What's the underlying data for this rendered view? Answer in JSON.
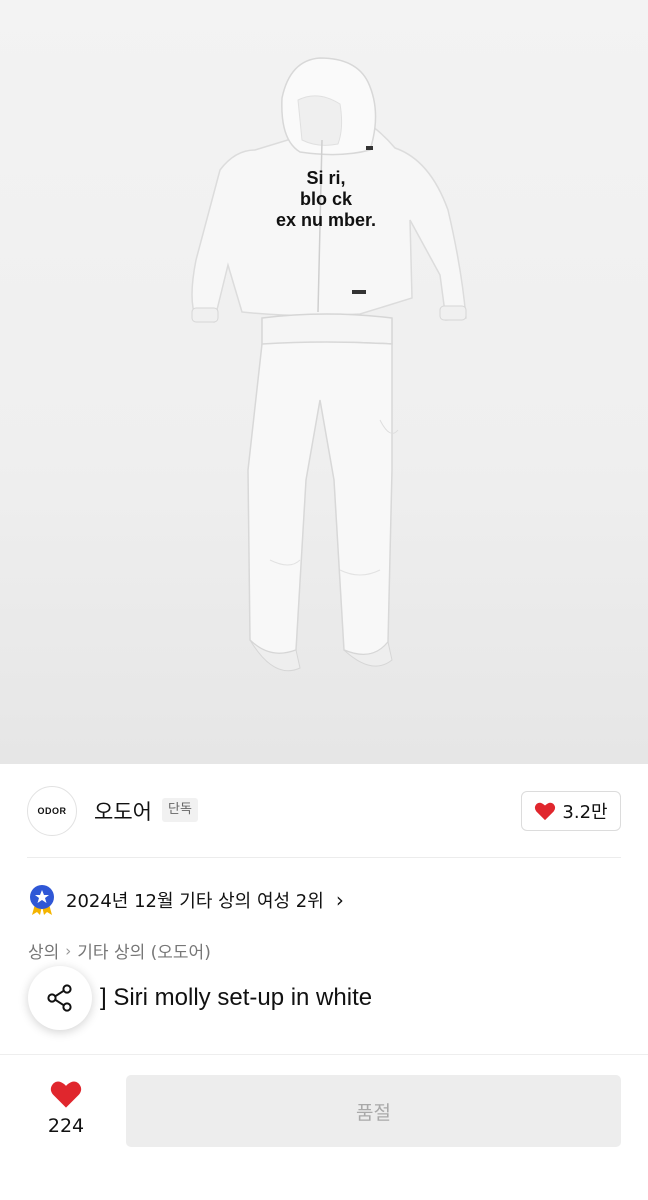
{
  "hero": {
    "image_subject": "white hoodie and pants set-up",
    "print_lines": [
      "Si ri,",
      "blo ck",
      "ex nu mber."
    ]
  },
  "brand": {
    "logo_text": "ODOR",
    "name": "오도어",
    "tag": "단독",
    "likes": "3.2만"
  },
  "ranking": {
    "text": "2024년 12월 기타 상의 여성 2위",
    "chevron": "›"
  },
  "breadcrumb": {
    "items": [
      "상의",
      "기타 상의 (오도어)"
    ],
    "separator": "›"
  },
  "product": {
    "title_suffix": "] Siri molly set-up in white"
  },
  "bottom_bar": {
    "wish_count": "224",
    "cta_label": "품절"
  },
  "colors": {
    "heart": "#e0262d",
    "badge_blue": "#2f57d6",
    "cta_bg": "#ededed",
    "cta_text": "#a9a9a9"
  }
}
